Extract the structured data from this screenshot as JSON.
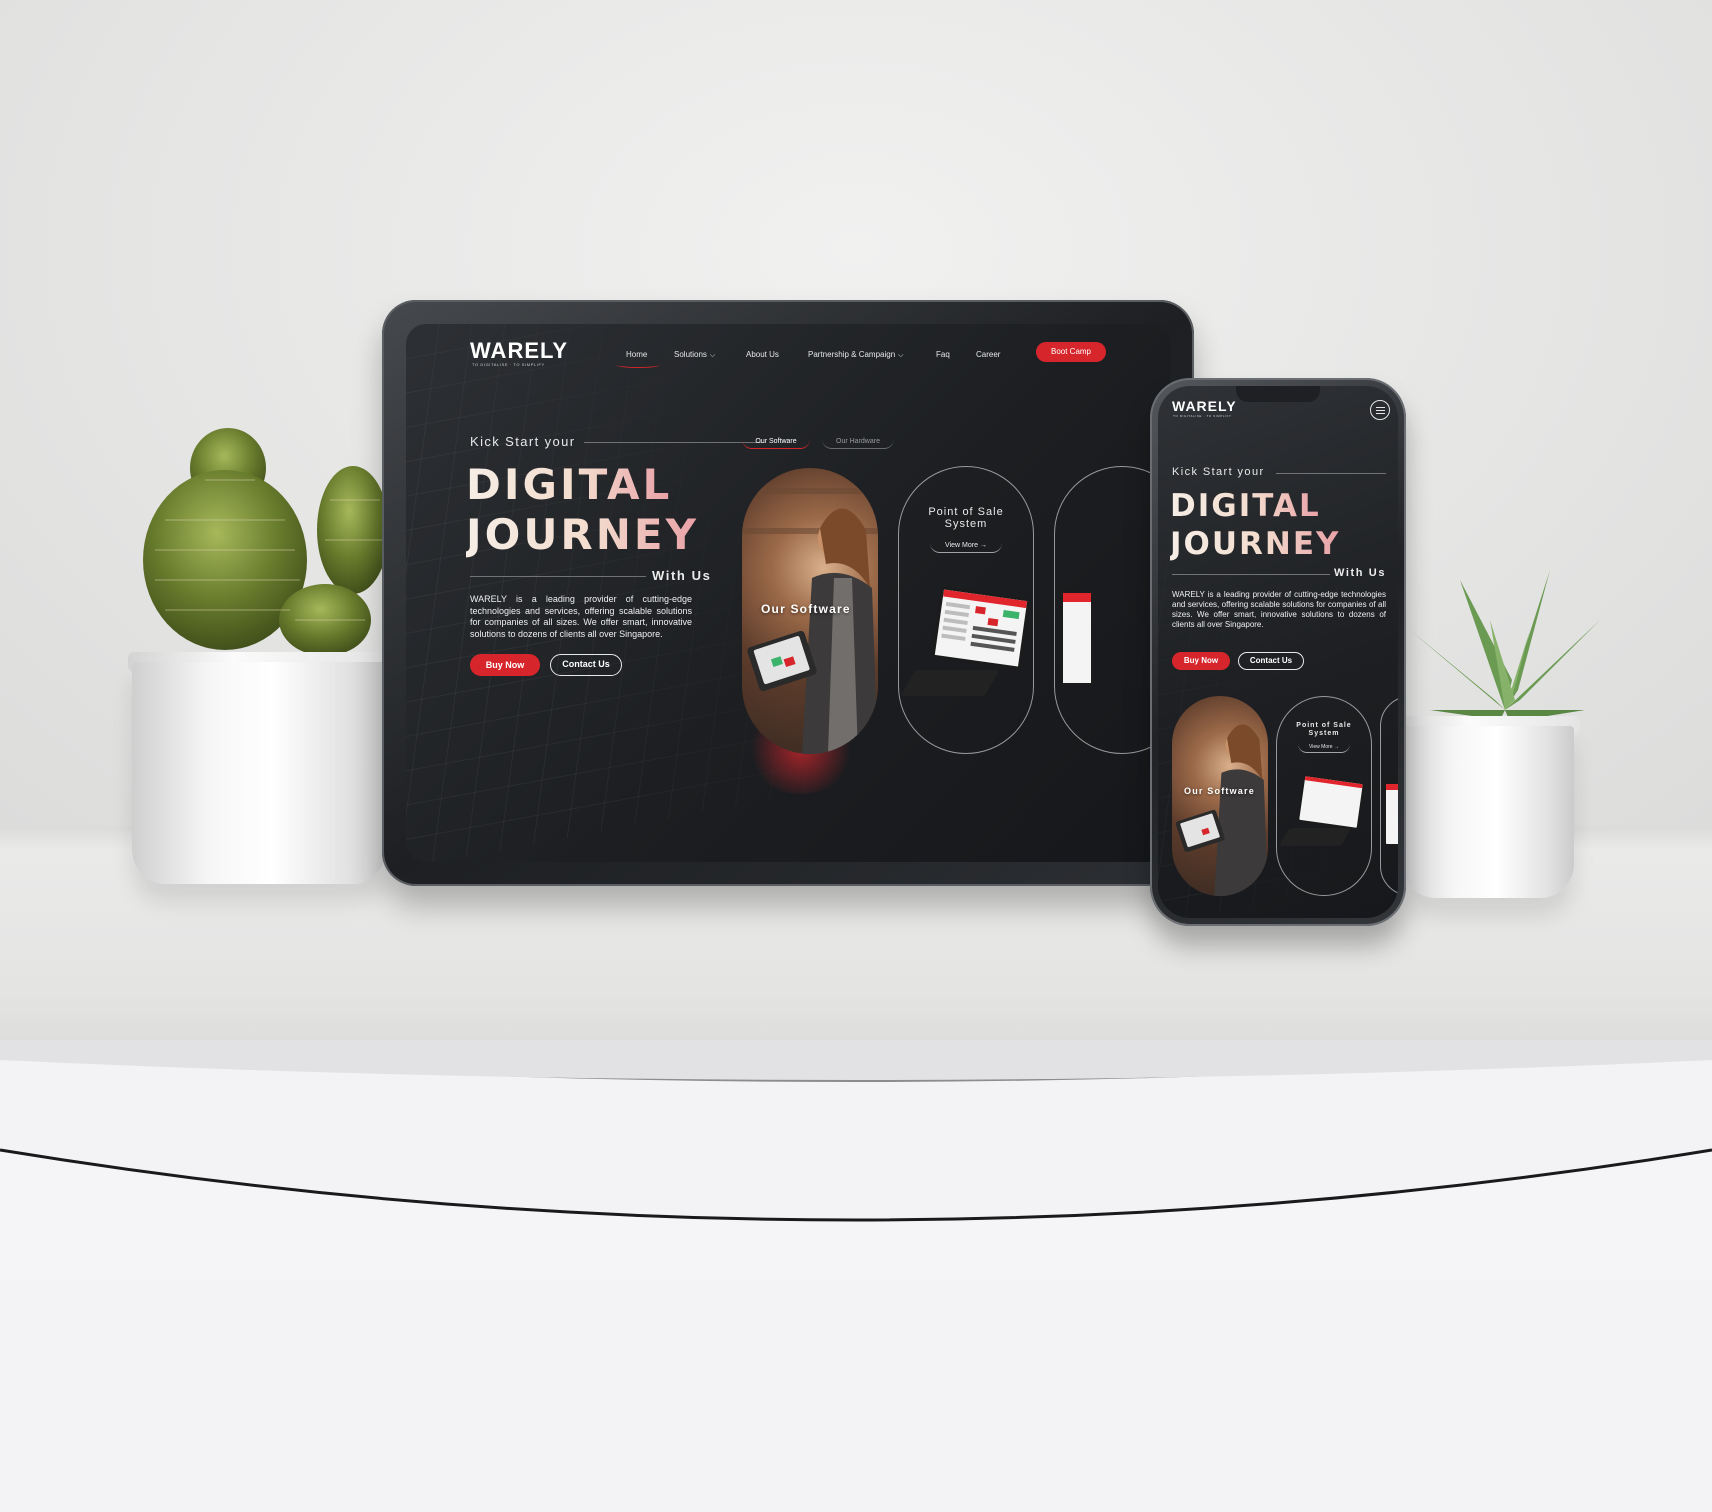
{
  "brand": {
    "logo": "WARELY",
    "tagline": "TO DIGITALISE · TO SIMPLIFY"
  },
  "nav": {
    "items": [
      "Home",
      "Solutions",
      "About Us",
      "Partnership & Campaign",
      "Faq",
      "Career"
    ],
    "cta": "Boot Camp",
    "dropdown_indicator": "chevron-down-icon"
  },
  "hero": {
    "kicker": "Kick Start your",
    "headline_line1": "DIGITAL",
    "headline_line2": "JOURNEY",
    "with_us": "With Us",
    "description": "WARELY is a leading provider of cutting-edge technologies and services, offering scalable solutions for companies of all sizes. We offer smart, innovative solutions to dozens of clients all over Singapore.",
    "buy_now": "Buy Now",
    "contact_us": "Contact Us"
  },
  "products": {
    "tabs": [
      "Our Software",
      "Our Hardware"
    ],
    "active_tab": "Our Software",
    "software_label": "Our Software",
    "pos_title_line1": "Point of Sale",
    "pos_title_line2": "System",
    "view_more": "View More"
  },
  "mobile": {
    "menu_icon": "hamburger-menu-icon"
  },
  "colors": {
    "accent_red": "#d6262c",
    "screen_bg": "#1c1e21",
    "headline_gradient_end": "#e9a0a6"
  }
}
